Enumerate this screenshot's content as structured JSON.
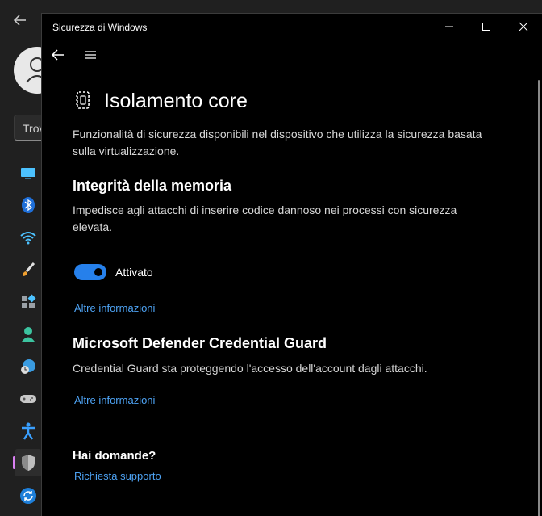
{
  "background_app": {
    "search_placeholder": "Trova"
  },
  "window": {
    "title": "Sicurezza di Windows"
  },
  "page": {
    "title": "Isolamento core",
    "description": "Funzionalità di sicurezza disponibili nel dispositivo che utilizza la sicurezza basata sulla virtualizzazione."
  },
  "memory_integrity": {
    "title": "Integrità della memoria",
    "description": "Impedisce agli attacchi di inserire codice dannoso nei processi con sicurezza elevata.",
    "toggle_state": "on",
    "toggle_label": "Attivato",
    "more_info": "Altre informazioni"
  },
  "credential_guard": {
    "title": "Microsoft Defender Credential Guard",
    "description": "Credential Guard sta proteggendo l'accesso dell'account dagli attacchi.",
    "more_info": "Altre informazioni"
  },
  "help": {
    "title": "Hai domande?",
    "support_link": "Richiesta supporto"
  },
  "colors": {
    "accent": "#2680eb",
    "link": "#4ea3f4",
    "window_bg": "#000000",
    "nav_indicator": "#d980f2"
  }
}
